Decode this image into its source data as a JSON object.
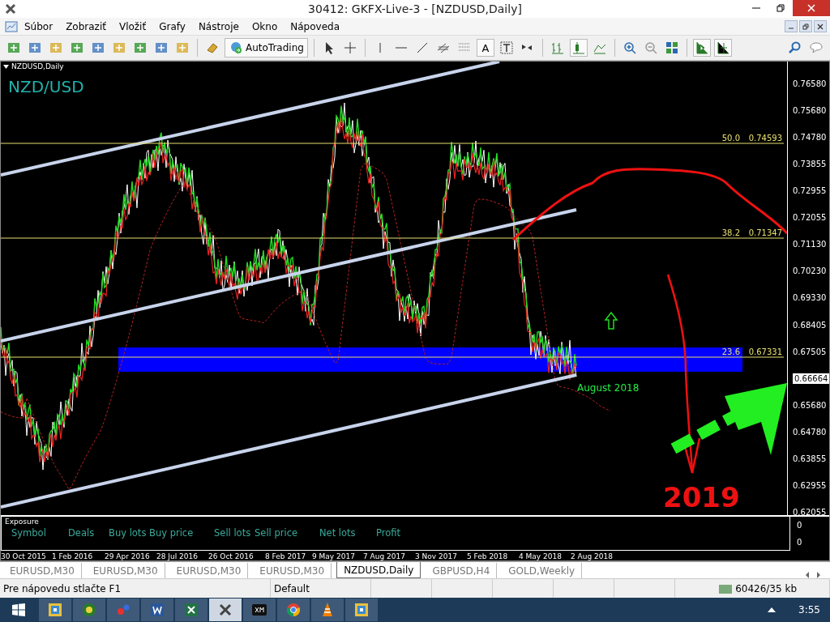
{
  "window": {
    "title": "30412: GKFX-Live-3 - [NZDUSD,Daily]"
  },
  "menu": [
    "Súbor",
    "Zobraziť",
    "Vložiť",
    "Grafy",
    "Nástroje",
    "Okno",
    "Nápoveda"
  ],
  "toolbar": {
    "autotrading": "AutoTrading",
    "text_tool": "A"
  },
  "chart": {
    "window_label": "NZDUSD,Daily",
    "symbol_title": "NZD/USD",
    "price_axis": [
      {
        "label": "0.76580",
        "current": false
      },
      {
        "label": "0.75680",
        "current": false
      },
      {
        "label": "0.74780",
        "current": false
      },
      {
        "label": "0.73855",
        "current": false
      },
      {
        "label": "0.72955",
        "current": false
      },
      {
        "label": "0.72055",
        "current": false
      },
      {
        "label": "0.71130",
        "current": false
      },
      {
        "label": "0.70230",
        "current": false
      },
      {
        "label": "0.69330",
        "current": false
      },
      {
        "label": "0.68405",
        "current": false
      },
      {
        "label": "0.67505",
        "current": false
      },
      {
        "label": "0.66664",
        "current": true
      },
      {
        "label": "0.65680",
        "current": false
      },
      {
        "label": "0.64780",
        "current": false
      },
      {
        "label": "0.63855",
        "current": false
      },
      {
        "label": "0.62955",
        "current": false
      },
      {
        "label": "0.62055",
        "current": false
      }
    ],
    "fib_levels": [
      {
        "level": "50.0",
        "price": "0.74593"
      },
      {
        "level": "38.2",
        "price": "0.71347"
      },
      {
        "level": "23.6",
        "price": "0.67331"
      }
    ],
    "annotations": {
      "support_label": "August 2018",
      "forecast_label": "2019"
    },
    "date_axis": [
      "30 Oct 2015",
      "1 Feb 2016",
      "29 Apr 2016",
      "28 Jul 2016",
      "26 Oct 2016",
      "8 Feb 2017",
      "9 May 2017",
      "7 Aug 2017",
      "3 Nov 2017",
      "5 Feb 2018",
      "4 May 2018",
      "2 Aug 2018"
    ]
  },
  "exposure": {
    "title": "Exposure",
    "columns": [
      "Symbol",
      "Deals",
      "Buy lots",
      "Buy price",
      "Sell lots",
      "Sell price",
      "Net lots",
      "Profit"
    ],
    "scale": [
      "0",
      "0"
    ]
  },
  "tabs": [
    {
      "label": "EURUSD,M30",
      "selected": false
    },
    {
      "label": "EURUSD,M30",
      "selected": false
    },
    {
      "label": "EURUSD,M30",
      "selected": false
    },
    {
      "label": "EURUSD,M30",
      "selected": false
    },
    {
      "label": "NZDUSD,Daily",
      "selected": true
    },
    {
      "label": "GBPUSD,H4",
      "selected": false
    },
    {
      "label": "GOLD,Weekly",
      "selected": false
    }
  ],
  "status_bar": {
    "help": "Pre nápovedu stlačte F1",
    "profile": "Default",
    "traffic": "60426/35 kb"
  },
  "taskbar": {
    "apps": [
      {
        "kind": "tiles",
        "selected": false
      },
      {
        "kind": "globe",
        "selected": false
      },
      {
        "kind": "dots",
        "selected": false
      },
      {
        "kind": "word",
        "selected": false
      },
      {
        "kind": "excel",
        "selected": false
      },
      {
        "kind": "cross",
        "selected": true
      },
      {
        "kind": "xm",
        "selected": false
      },
      {
        "kind": "chrome",
        "selected": false
      },
      {
        "kind": "cone",
        "selected": false
      },
      {
        "kind": "tiles",
        "selected": false
      }
    ],
    "clock": "3:55"
  }
}
